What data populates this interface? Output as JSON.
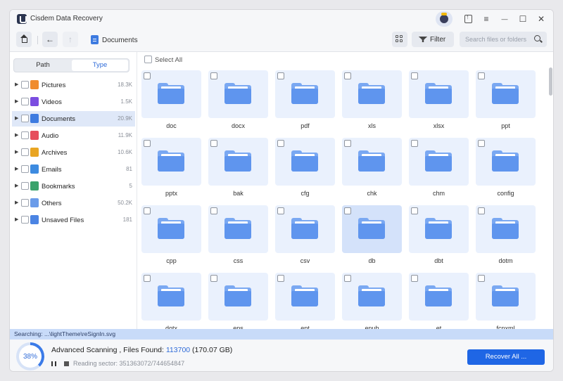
{
  "app": {
    "title": "Cisdem Data Recovery"
  },
  "window_controls": {
    "menu": "≡",
    "minimize": "—",
    "maximize": "☐",
    "close": "✕"
  },
  "toolbar": {
    "back": "←",
    "forward": "↑",
    "breadcrumb": "Documents",
    "filter_label": "Filter",
    "search_placeholder": "Search files or folders"
  },
  "sidebar": {
    "tabs": [
      {
        "label": "Path",
        "active": false
      },
      {
        "label": "Type",
        "active": true
      }
    ],
    "categories": [
      {
        "label": "Pictures",
        "count": "18.3K",
        "icon": "pictures-icon",
        "color": "#f08c2e"
      },
      {
        "label": "Videos",
        "count": "1.5K",
        "icon": "videos-icon",
        "color": "#7b4de0"
      },
      {
        "label": "Documents",
        "count": "20.9K",
        "icon": "documents-icon",
        "color": "#3d7be0",
        "selected": true
      },
      {
        "label": "Audio",
        "count": "11.9K",
        "icon": "audio-icon",
        "color": "#e64d5c"
      },
      {
        "label": "Archives",
        "count": "10.6K",
        "icon": "archives-icon",
        "color": "#e9a523"
      },
      {
        "label": "Emails",
        "count": "81",
        "icon": "emails-icon",
        "color": "#3d8be0"
      },
      {
        "label": "Bookmarks",
        "count": "5",
        "icon": "bookmarks-icon",
        "color": "#3aa26b"
      },
      {
        "label": "Others",
        "count": "50.2K",
        "icon": "folder-icon",
        "color": "#6a9be9"
      },
      {
        "label": "Unsaved Files",
        "count": "181",
        "icon": "unsaved-files-icon",
        "color": "#4b84e3"
      }
    ]
  },
  "main": {
    "select_all": "Select All",
    "folders": [
      "doc",
      "docx",
      "pdf",
      "xls",
      "xlsx",
      "ppt",
      "pptx",
      "bak",
      "cfg",
      "chk",
      "chm",
      "config",
      "cpp",
      "css",
      "csv",
      "db",
      "dbt",
      "dotm",
      "dotx",
      "eps",
      "ept",
      "epub",
      "et",
      "fcpxml"
    ]
  },
  "status": {
    "searching": "Searching: ...\\lightTheme\\reSignIn.svg",
    "progress_percent": "38%",
    "progress_value": 0.38,
    "scan_label": "Advanced Scanning , Files Found: ",
    "files_found": "113700",
    "size": " (170.07 GB)",
    "sector": "Reading sector: 351363072/744654847",
    "recover_all": "Recover All ..."
  },
  "colors": {
    "accent": "#1f66e5",
    "tile_bg": "#eaf1fd",
    "folder": "#5f95ee"
  }
}
